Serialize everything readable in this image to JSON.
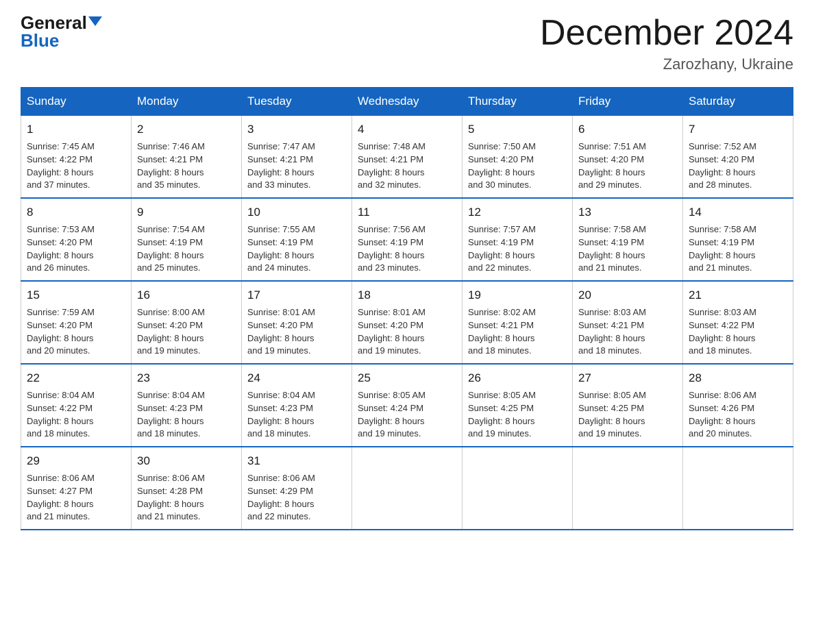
{
  "logo": {
    "general": "General",
    "blue": "Blue"
  },
  "title": "December 2024",
  "location": "Zarozhany, Ukraine",
  "days_of_week": [
    "Sunday",
    "Monday",
    "Tuesday",
    "Wednesday",
    "Thursday",
    "Friday",
    "Saturday"
  ],
  "weeks": [
    [
      {
        "day": "1",
        "sunrise": "7:45 AM",
        "sunset": "4:22 PM",
        "daylight": "8 hours and 37 minutes."
      },
      {
        "day": "2",
        "sunrise": "7:46 AM",
        "sunset": "4:21 PM",
        "daylight": "8 hours and 35 minutes."
      },
      {
        "day": "3",
        "sunrise": "7:47 AM",
        "sunset": "4:21 PM",
        "daylight": "8 hours and 33 minutes."
      },
      {
        "day": "4",
        "sunrise": "7:48 AM",
        "sunset": "4:21 PM",
        "daylight": "8 hours and 32 minutes."
      },
      {
        "day": "5",
        "sunrise": "7:50 AM",
        "sunset": "4:20 PM",
        "daylight": "8 hours and 30 minutes."
      },
      {
        "day": "6",
        "sunrise": "7:51 AM",
        "sunset": "4:20 PM",
        "daylight": "8 hours and 29 minutes."
      },
      {
        "day": "7",
        "sunrise": "7:52 AM",
        "sunset": "4:20 PM",
        "daylight": "8 hours and 28 minutes."
      }
    ],
    [
      {
        "day": "8",
        "sunrise": "7:53 AM",
        "sunset": "4:20 PM",
        "daylight": "8 hours and 26 minutes."
      },
      {
        "day": "9",
        "sunrise": "7:54 AM",
        "sunset": "4:19 PM",
        "daylight": "8 hours and 25 minutes."
      },
      {
        "day": "10",
        "sunrise": "7:55 AM",
        "sunset": "4:19 PM",
        "daylight": "8 hours and 24 minutes."
      },
      {
        "day": "11",
        "sunrise": "7:56 AM",
        "sunset": "4:19 PM",
        "daylight": "8 hours and 23 minutes."
      },
      {
        "day": "12",
        "sunrise": "7:57 AM",
        "sunset": "4:19 PM",
        "daylight": "8 hours and 22 minutes."
      },
      {
        "day": "13",
        "sunrise": "7:58 AM",
        "sunset": "4:19 PM",
        "daylight": "8 hours and 21 minutes."
      },
      {
        "day": "14",
        "sunrise": "7:58 AM",
        "sunset": "4:19 PM",
        "daylight": "8 hours and 21 minutes."
      }
    ],
    [
      {
        "day": "15",
        "sunrise": "7:59 AM",
        "sunset": "4:20 PM",
        "daylight": "8 hours and 20 minutes."
      },
      {
        "day": "16",
        "sunrise": "8:00 AM",
        "sunset": "4:20 PM",
        "daylight": "8 hours and 19 minutes."
      },
      {
        "day": "17",
        "sunrise": "8:01 AM",
        "sunset": "4:20 PM",
        "daylight": "8 hours and 19 minutes."
      },
      {
        "day": "18",
        "sunrise": "8:01 AM",
        "sunset": "4:20 PM",
        "daylight": "8 hours and 19 minutes."
      },
      {
        "day": "19",
        "sunrise": "8:02 AM",
        "sunset": "4:21 PM",
        "daylight": "8 hours and 18 minutes."
      },
      {
        "day": "20",
        "sunrise": "8:03 AM",
        "sunset": "4:21 PM",
        "daylight": "8 hours and 18 minutes."
      },
      {
        "day": "21",
        "sunrise": "8:03 AM",
        "sunset": "4:22 PM",
        "daylight": "8 hours and 18 minutes."
      }
    ],
    [
      {
        "day": "22",
        "sunrise": "8:04 AM",
        "sunset": "4:22 PM",
        "daylight": "8 hours and 18 minutes."
      },
      {
        "day": "23",
        "sunrise": "8:04 AM",
        "sunset": "4:23 PM",
        "daylight": "8 hours and 18 minutes."
      },
      {
        "day": "24",
        "sunrise": "8:04 AM",
        "sunset": "4:23 PM",
        "daylight": "8 hours and 18 minutes."
      },
      {
        "day": "25",
        "sunrise": "8:05 AM",
        "sunset": "4:24 PM",
        "daylight": "8 hours and 19 minutes."
      },
      {
        "day": "26",
        "sunrise": "8:05 AM",
        "sunset": "4:25 PM",
        "daylight": "8 hours and 19 minutes."
      },
      {
        "day": "27",
        "sunrise": "8:05 AM",
        "sunset": "4:25 PM",
        "daylight": "8 hours and 19 minutes."
      },
      {
        "day": "28",
        "sunrise": "8:06 AM",
        "sunset": "4:26 PM",
        "daylight": "8 hours and 20 minutes."
      }
    ],
    [
      {
        "day": "29",
        "sunrise": "8:06 AM",
        "sunset": "4:27 PM",
        "daylight": "8 hours and 21 minutes."
      },
      {
        "day": "30",
        "sunrise": "8:06 AM",
        "sunset": "4:28 PM",
        "daylight": "8 hours and 21 minutes."
      },
      {
        "day": "31",
        "sunrise": "8:06 AM",
        "sunset": "4:29 PM",
        "daylight": "8 hours and 22 minutes."
      },
      null,
      null,
      null,
      null
    ]
  ],
  "labels": {
    "sunrise": "Sunrise:",
    "sunset": "Sunset:",
    "daylight": "Daylight:"
  }
}
